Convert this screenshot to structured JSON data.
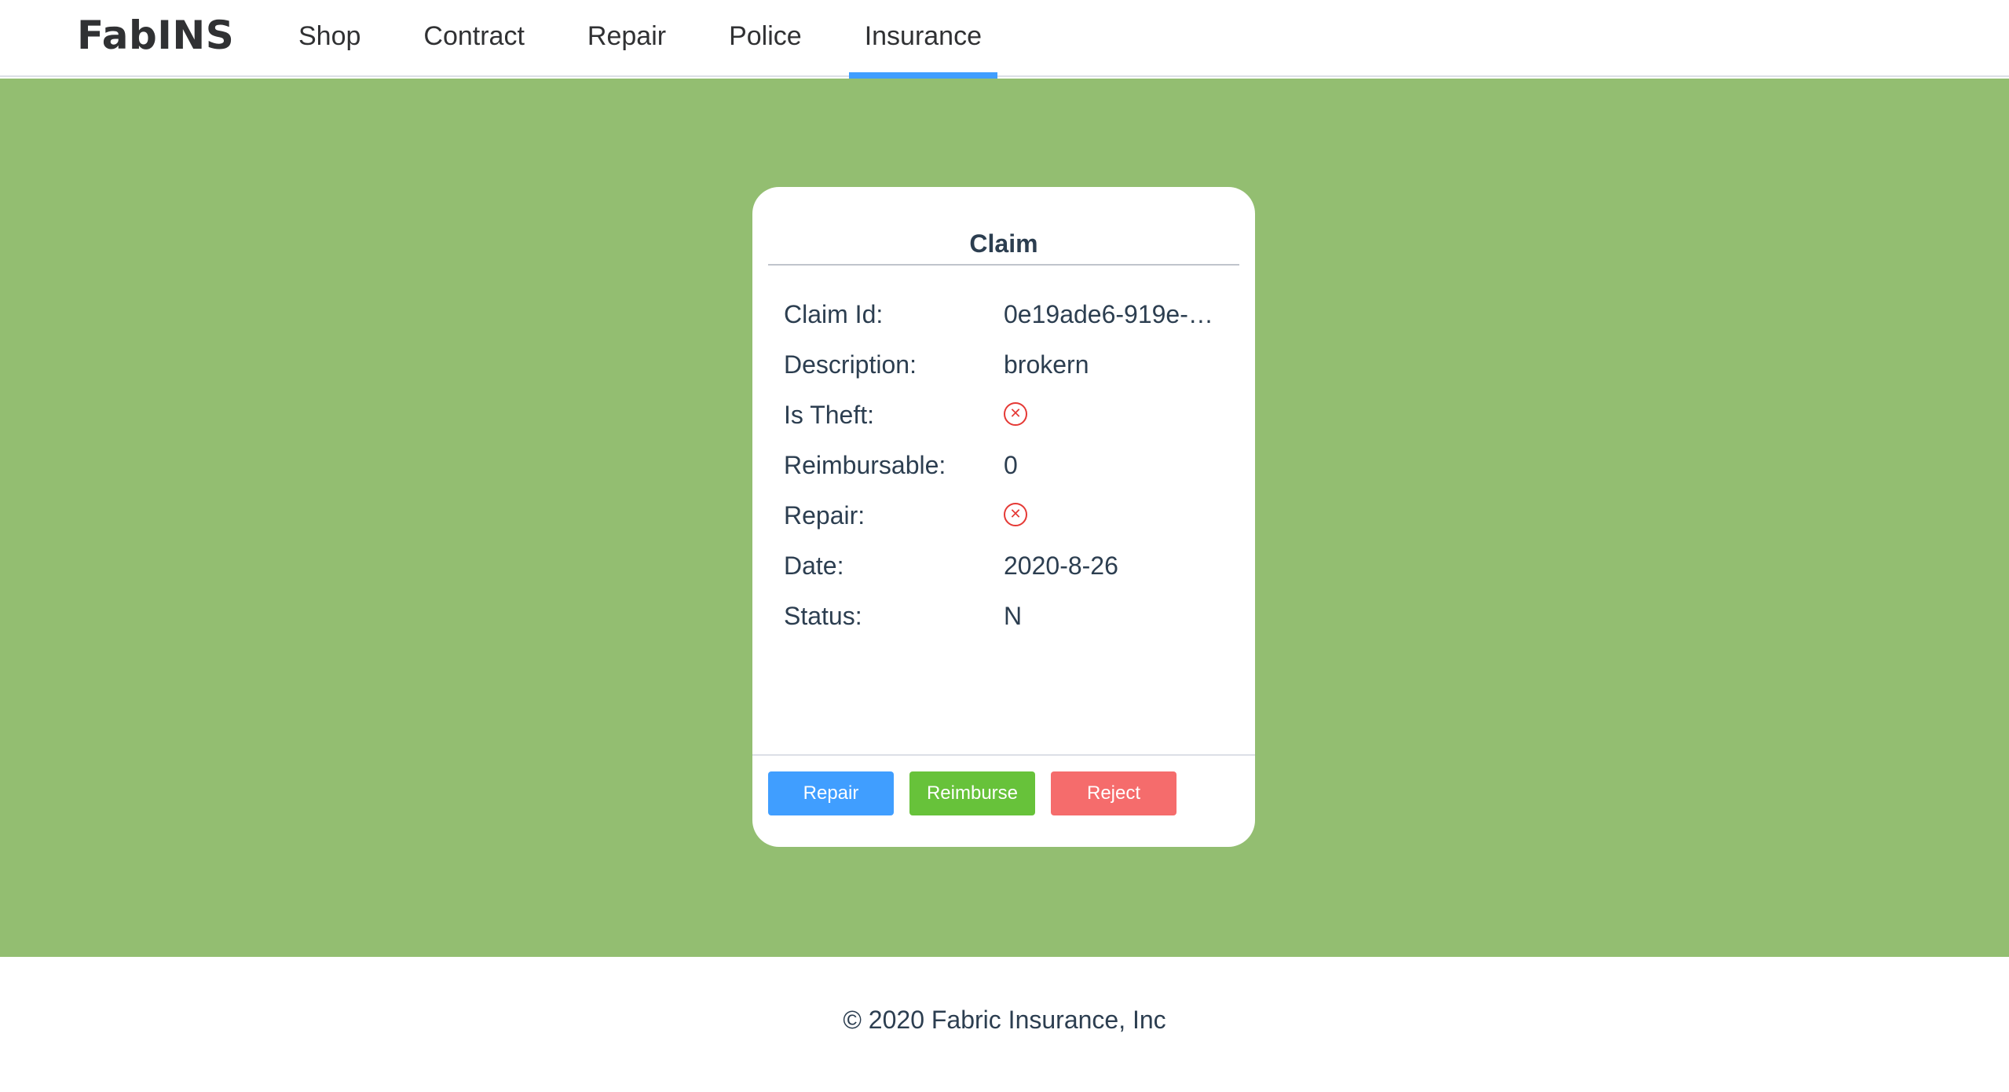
{
  "header": {
    "brand": "FabINS",
    "nav": [
      {
        "label": "Shop",
        "active": false
      },
      {
        "label": "Contract",
        "active": false
      },
      {
        "label": "Repair",
        "active": false
      },
      {
        "label": "Police",
        "active": false
      },
      {
        "label": "Insurance",
        "active": true
      }
    ]
  },
  "card": {
    "title": "Claim",
    "rows": [
      {
        "label": "Claim Id:",
        "value": "0e19ade6-919e-…"
      },
      {
        "label": "Description:",
        "value": "brokern"
      },
      {
        "label": "Is Theft:",
        "value": "",
        "icon": "circle-x-icon"
      },
      {
        "label": "Reimbursable:",
        "value": "0"
      },
      {
        "label": "Repair:",
        "value": "",
        "icon": "circle-x-icon"
      },
      {
        "label": "Date:",
        "value": "2020-8-26"
      },
      {
        "label": "Status:",
        "value": "N"
      }
    ],
    "buttons": {
      "repair": "Repair",
      "reimburse": "Reimburse",
      "reject": "Reject"
    }
  },
  "footer": {
    "text": "© 2020 Fabric Insurance, Inc"
  },
  "colors": {
    "background_green": "#93be71",
    "accent_blue": "#409eff",
    "success_green": "#67c23a",
    "danger_red": "#f56c6c",
    "icon_red": "#e53935"
  }
}
